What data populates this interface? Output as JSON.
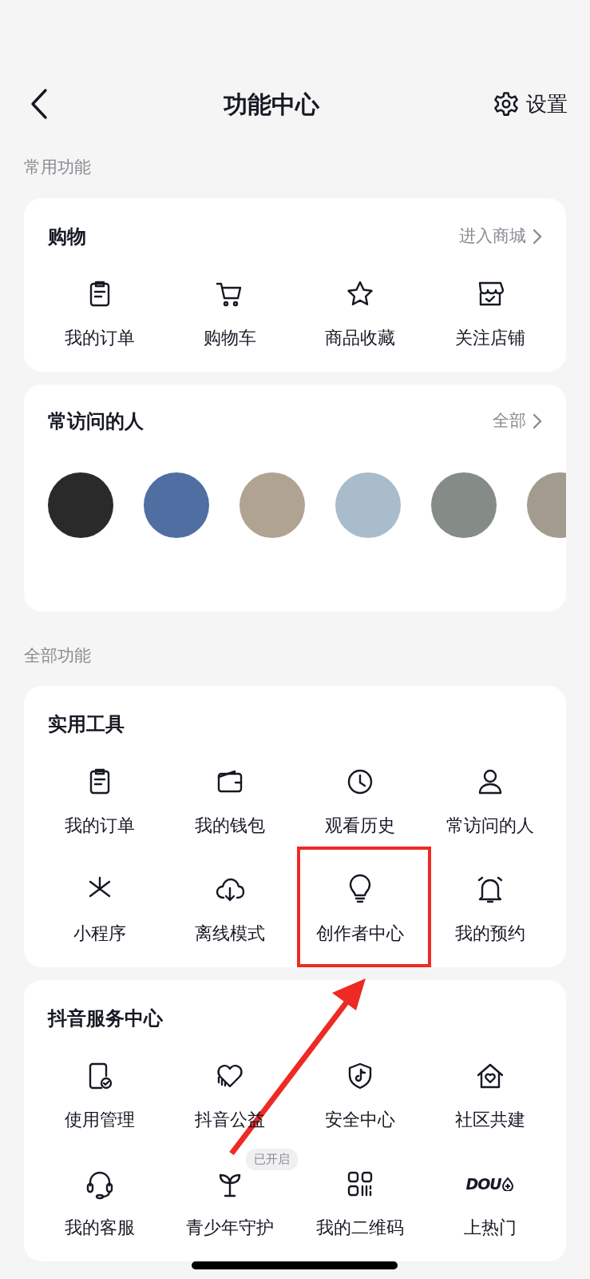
{
  "header": {
    "title": "功能中心",
    "settings": "设置"
  },
  "sections": [
    {
      "label": "常用功能",
      "cards": [
        {
          "kind": "grid",
          "title": "购物",
          "link": "进入商城",
          "rows": [
            [
              {
                "label": "我的订单"
              },
              {
                "label": "购物车"
              },
              {
                "label": "商品收藏"
              },
              {
                "label": "关注店铺"
              }
            ]
          ]
        },
        {
          "kind": "people",
          "title": "常访问的人",
          "link": "全部",
          "people": [
            {
              "color": "#2a2a2a"
            },
            {
              "color": "#4f6fa3"
            },
            {
              "color": "#b0a392"
            },
            {
              "color": "#a9bccb"
            },
            {
              "color": "#858c88"
            },
            {
              "color": "#a39c8e"
            }
          ]
        }
      ]
    },
    {
      "label": "全部功能",
      "cards": [
        {
          "kind": "grid",
          "title": "实用工具",
          "rows": [
            [
              {
                "label": "我的订单"
              },
              {
                "label": "我的钱包"
              },
              {
                "label": "观看历史"
              },
              {
                "label": "常访问的人"
              }
            ],
            [
              {
                "label": "小程序"
              },
              {
                "label": "离线模式"
              },
              {
                "label": "创作者中心",
                "highlighted": true,
                "pointer_arrow": true
              },
              {
                "label": "我的预约"
              }
            ]
          ]
        },
        {
          "kind": "grid",
          "title": "抖音服务中心",
          "rows": [
            [
              {
                "label": "使用管理"
              },
              {
                "label": "抖音公益"
              },
              {
                "label": "安全中心"
              },
              {
                "label": "社区共建"
              }
            ],
            [
              {
                "label": "我的客服"
              },
              {
                "label": "青少年守护",
                "badge": "已开启"
              },
              {
                "label": "我的二维码"
              },
              {
                "label": "上热门",
                "icon_text": "DOU"
              }
            ]
          ]
        }
      ]
    }
  ]
}
